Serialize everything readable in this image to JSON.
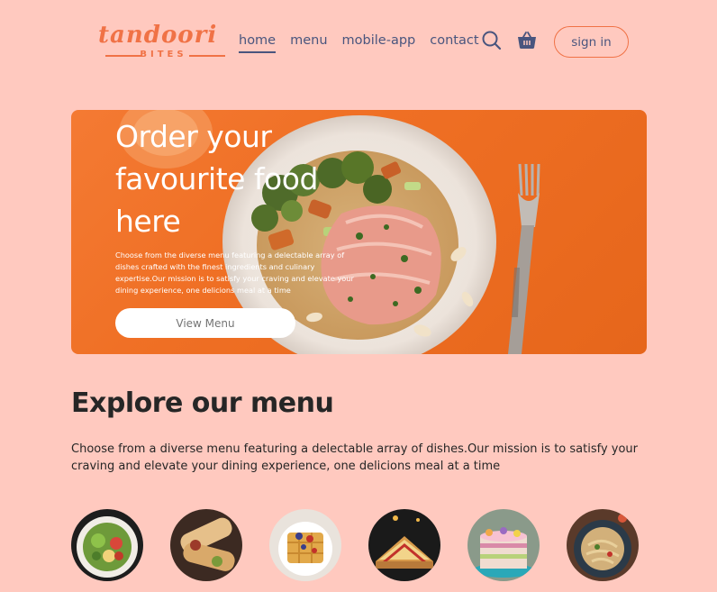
{
  "logo": {
    "main": "tandoori",
    "sub": "BITES"
  },
  "nav": {
    "links": [
      {
        "label": "home",
        "active": true
      },
      {
        "label": "menu",
        "active": false
      },
      {
        "label": "mobile-app",
        "active": false
      },
      {
        "label": "contact",
        "active": false
      }
    ],
    "search_icon": "search-icon",
    "basket_icon": "basket-icon",
    "signin_label": "sign in"
  },
  "hero": {
    "title": "Order your favourite food here",
    "description": "Choose from the diverse menu featuring a delectable array of dishes crafted with the finest ingredients and culinary expertise.Our mission is to satisfy your craving and elevate your dining experience, one delicions meal at a time",
    "button_label": "View Menu"
  },
  "explore": {
    "title": "Explore our menu",
    "text": "Choose from a diverse menu featuring a delectable array of dishes.Our mission is to satisfy your craving and elevate your dining experience, one delicions meal at a time"
  },
  "colors": {
    "background": "#ffc9bf",
    "accent": "#f07246",
    "nav_text": "#49557e",
    "hero_orange": "#ef6f24"
  }
}
